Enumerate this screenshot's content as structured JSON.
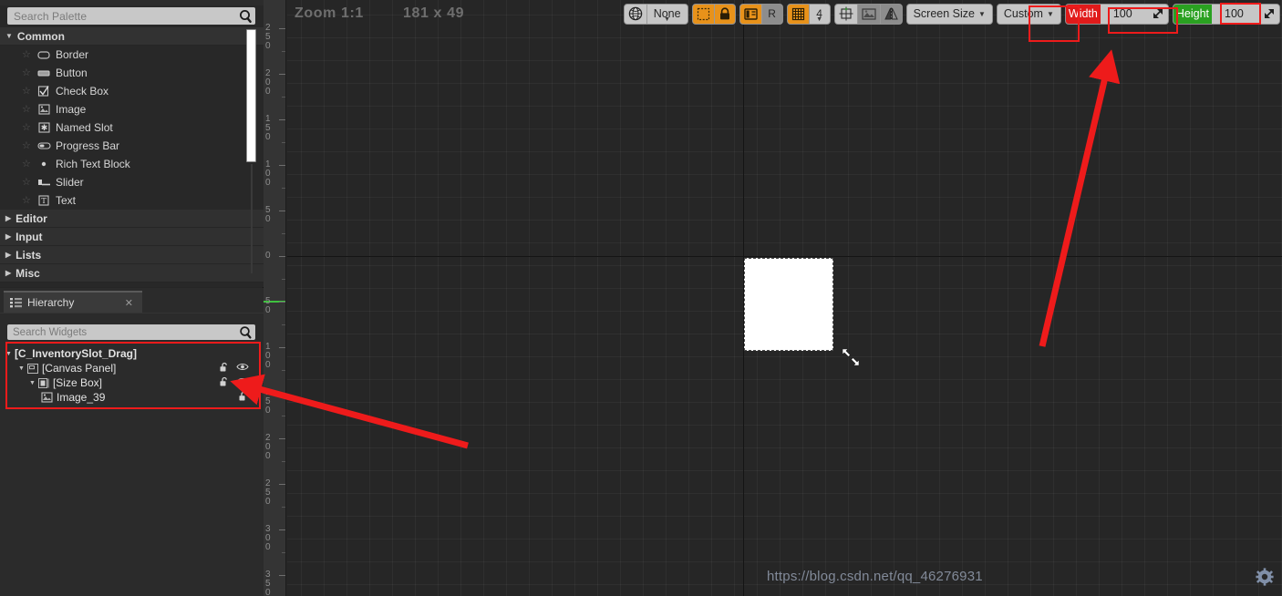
{
  "palette": {
    "search_placeholder": "Search Palette",
    "search_icon": "search-icon",
    "categories": [
      {
        "label": "Common",
        "expanded": true,
        "items": [
          {
            "label": "Border",
            "icon": "border-icon"
          },
          {
            "label": "Button",
            "icon": "button-icon"
          },
          {
            "label": "Check Box",
            "icon": "checkbox-icon"
          },
          {
            "label": "Image",
            "icon": "image-icon"
          },
          {
            "label": "Named Slot",
            "icon": "named-slot-icon"
          },
          {
            "label": "Progress Bar",
            "icon": "progress-bar-icon"
          },
          {
            "label": "Rich Text Block",
            "icon": "rich-text-icon"
          },
          {
            "label": "Slider",
            "icon": "slider-icon"
          },
          {
            "label": "Text",
            "icon": "text-icon"
          }
        ]
      },
      {
        "label": "Editor",
        "expanded": false,
        "items": []
      },
      {
        "label": "Input",
        "expanded": false,
        "items": []
      },
      {
        "label": "Lists",
        "expanded": false,
        "items": []
      },
      {
        "label": "Misc",
        "expanded": false,
        "items": []
      }
    ]
  },
  "hierarchy": {
    "tab_label": "Hierarchy",
    "tab_icon": "hierarchy-icon",
    "close_icon": "close-icon",
    "search_placeholder": "Search Widgets",
    "search_icon": "search-icon",
    "nodes": [
      {
        "label": "[C_InventorySlot_Drag]",
        "depth": 0,
        "icon": "",
        "expander": "expanded",
        "lock": false,
        "eye": false
      },
      {
        "label": "[Canvas Panel]",
        "depth": 1,
        "icon": "canvas-panel-icon",
        "expander": "expanded",
        "lock": true,
        "eye": true
      },
      {
        "label": "[Size Box]",
        "depth": 2,
        "icon": "size-box-icon",
        "expander": "expanded",
        "lock": true,
        "eye": true
      },
      {
        "label": "Image_39",
        "depth": 3,
        "icon": "image-icon",
        "expander": "none",
        "lock": true,
        "eye": false
      }
    ]
  },
  "toolbar": {
    "globe_icon": "globe-icon",
    "fill_label": "None",
    "dashed_box_icon": "selection-outline-icon",
    "lock_icon": "lock-icon",
    "layout_icon": "layout-toggle-icon",
    "r_label": "R",
    "grid_icon": "grid-snap-icon",
    "grid_size": "4",
    "fit_icon": "fit-to-screen-icon",
    "image_icon": "image-preview-icon",
    "mirror_icon": "mirror-icon",
    "screen_size_label": "Screen Size",
    "resolution_label": "Custom",
    "width_label": "Width",
    "width_value": "100",
    "height_label": "Height",
    "height_value": "100",
    "spinner_icon": "drag-spinner-icon"
  },
  "canvas": {
    "zoom_label": "Zoom 1:1",
    "size_label": "181 x 49",
    "resize_cursor_icon": "resize-diagonal-cursor"
  },
  "ruler": {
    "labels_above": [
      "250",
      "200",
      "150",
      "100",
      "50",
      "0"
    ],
    "labels_below": [
      "50",
      "100",
      "150",
      "200",
      "250",
      "300",
      "350"
    ]
  },
  "watermark": {
    "url": "https://blog.csdn.net/qq_46276931",
    "gear_icon": "gear-icon"
  },
  "annotations": {
    "color": "#ee1b1b"
  }
}
